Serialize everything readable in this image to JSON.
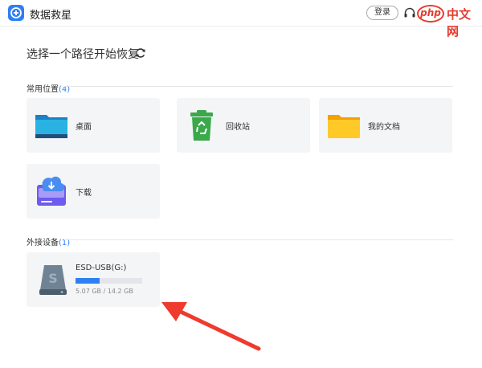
{
  "app": {
    "title": "数据救星"
  },
  "header": {
    "login_label": "登录"
  },
  "watermark": {
    "logo_text": "php",
    "text": "中文网"
  },
  "main": {
    "prompt": "选择一个路径开始恢复"
  },
  "common_section": {
    "label": "常用位置",
    "count": "(4)",
    "items": [
      {
        "label": "桌面",
        "icon": "desktop-folder-icon"
      },
      {
        "label": "回收站",
        "icon": "recycle-bin-icon"
      },
      {
        "label": "我的文档",
        "icon": "documents-folder-icon"
      },
      {
        "label": "下载",
        "icon": "downloads-icon"
      }
    ]
  },
  "external_section": {
    "label": "外接设备",
    "count": "(1)",
    "devices": [
      {
        "name": "ESD-USB(G:)",
        "used": "5.07 GB",
        "total": "14.2 GB",
        "size_text": "5.07 GB / 14.2 GB",
        "used_fraction": 0.357,
        "icon": "drive-icon"
      }
    ]
  },
  "annotation": {
    "icon": "arrow-icon",
    "color": "#ee3b2e"
  },
  "colors": {
    "accent": "#2f7ff2",
    "card_bg": "#f4f5f7",
    "arrow": "#ee3b2e"
  }
}
